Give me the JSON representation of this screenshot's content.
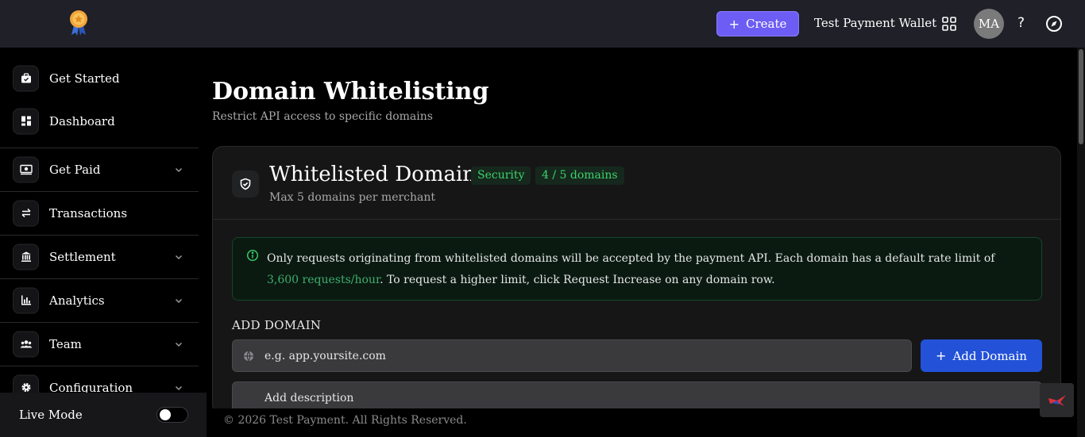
{
  "topbar": {
    "create_label": "Create",
    "wallet_name": "Test Payment Wallet",
    "avatar_initials": "MA",
    "help_label": "?"
  },
  "sidebar": {
    "items": [
      {
        "label": "Get Started",
        "icon": "briefcase-check-icon",
        "has_chevron": false
      },
      {
        "label": "Dashboard",
        "icon": "dashboard-icon",
        "has_chevron": false
      },
      {
        "label": "Get Paid",
        "icon": "money-icon",
        "has_chevron": true
      },
      {
        "label": "Transactions",
        "icon": "arrows-swap-icon",
        "has_chevron": false
      },
      {
        "label": "Settlement",
        "icon": "bank-icon",
        "has_chevron": true
      },
      {
        "label": "Analytics",
        "icon": "bar-chart-icon",
        "has_chevron": true
      },
      {
        "label": "Team",
        "icon": "team-icon",
        "has_chevron": true
      },
      {
        "label": "Configuration",
        "icon": "gear-icon",
        "has_chevron": true
      }
    ],
    "live_mode_label": "Live Mode",
    "live_mode_on": false
  },
  "page": {
    "title": "Domain Whitelisting",
    "subtitle": "Restrict API access to specific domains"
  },
  "card": {
    "title": "Whitelisted Domains",
    "badge_security": "Security",
    "badge_count": "4 / 5 domains",
    "subtitle": "Max 5 domains per merchant",
    "info_before": "Only requests originating from whitelisted domains will be accepted by the payment API. Each domain has a default rate limit of ",
    "info_highlight": "3,600 requests/hour",
    "info_after": ". To request a higher limit, click Request Increase on any domain row.",
    "add_domain_heading": "ADD DOMAIN",
    "domain_placeholder": "e.g. app.yoursite.com",
    "add_button_label": "Add Domain",
    "description_placeholder": "Add description"
  },
  "footer": {
    "copyright": "© 2026 Test Payment. All Rights Reserved."
  },
  "colors": {
    "accent_purple": "#6d5df4",
    "primary_blue": "#2352d8",
    "success_green": "#3dd26b"
  }
}
